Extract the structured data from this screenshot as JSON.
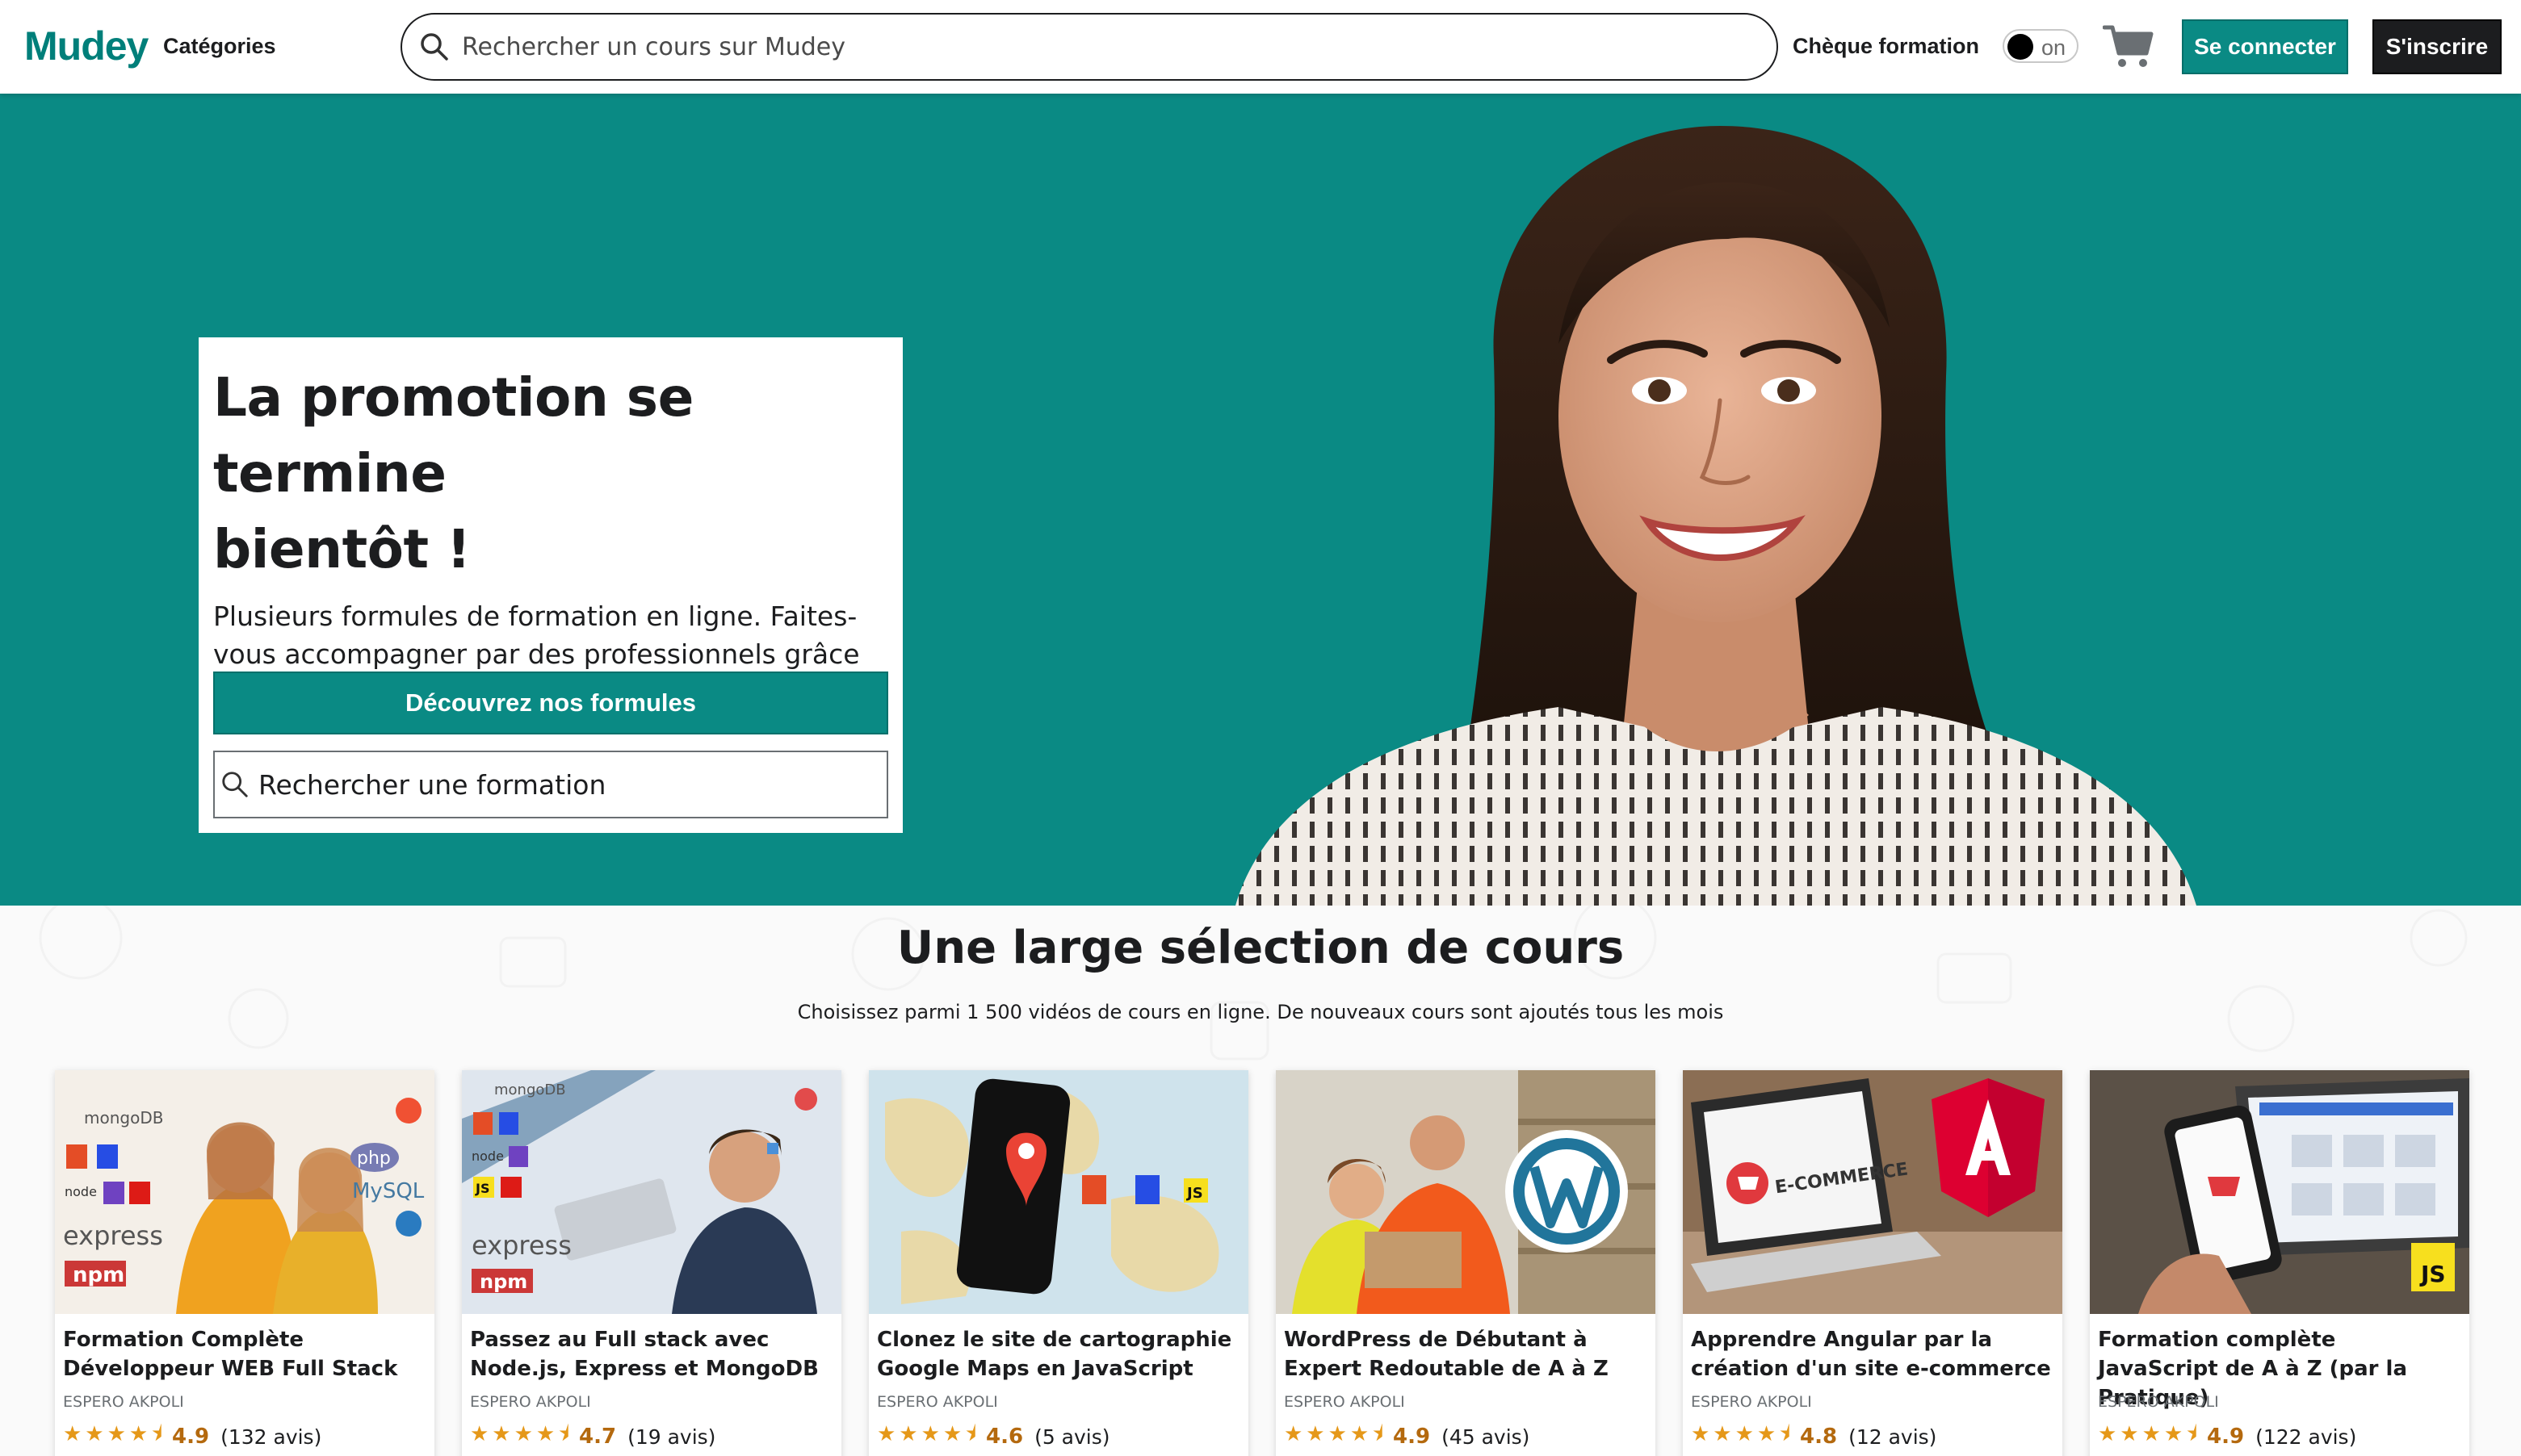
{
  "header": {
    "logo": "Mudey",
    "categories": "Catégories",
    "search_placeholder": "Rechercher un cours sur Mudey",
    "cheque": "Chèque formation",
    "toggle_label": "on",
    "login": "Se connecter",
    "signup": "S'inscrire",
    "icons": {
      "search": "search-icon",
      "cart": "cart-icon"
    }
  },
  "hero": {
    "title_line1": "La promotion se termine",
    "title_line2": "bientôt !",
    "text": "Plusieurs formules de formation en ligne. Faites-vous accompagner par des professionnels grâce la formule business.",
    "cta": "Découvrez nos formules",
    "search_placeholder": "Rechercher une formation"
  },
  "selection": {
    "title": "Une large sélection de cours",
    "subtitle": "Choisissez parmi 1 500 vidéos de cours en ligne. De nouveaux cours sont ajoutés tous les mois"
  },
  "courses": [
    {
      "title": "Formation Complète Développeur WEB Full Stack",
      "author": "ESPERO AKPOLI",
      "rating": "4.9",
      "reviews": "(132 avis)",
      "stars": "★★★★⯨"
    },
    {
      "title": "Passez au Full stack avec Node.js, Express et MongoDB",
      "author": "ESPERO AKPOLI",
      "rating": "4.7",
      "reviews": "(19 avis)",
      "stars": "★★★★⯨"
    },
    {
      "title": "Clonez le site de cartographie Google Maps en JavaScript",
      "author": "ESPERO AKPOLI",
      "rating": "4.6",
      "reviews": "(5 avis)",
      "stars": "★★★★⯨"
    },
    {
      "title": "WordPress de Débutant à Expert Redoutable de A à Z",
      "author": "ESPERO AKPOLI",
      "rating": "4.9",
      "reviews": "(45 avis)",
      "stars": "★★★★⯨"
    },
    {
      "title": "Apprendre Angular par la création d'un site e-commerce",
      "author": "ESPERO AKPOLI",
      "rating": "4.8",
      "reviews": "(12 avis)",
      "stars": "★★★★⯨"
    },
    {
      "title": "Formation complète JavaScript de A à Z (par la Pratique)",
      "author": "ESPERO AKPOLI",
      "rating": "4.9",
      "reviews": "(122 avis)",
      "stars": "★★★★⯨"
    }
  ],
  "thumb_text": {
    "mongo": "mongoDB",
    "node": "node",
    "express": "express",
    "npm": "npm",
    "php": "php",
    "mysql": "MySQL",
    "js": "JS",
    "ecommerce": "E-COMMERCE"
  },
  "colors": {
    "brand": "#0a8a84",
    "logo": "#007f7a",
    "star": "#e59819",
    "rating": "#b4690e",
    "dark_button": "#1c1d1f"
  }
}
